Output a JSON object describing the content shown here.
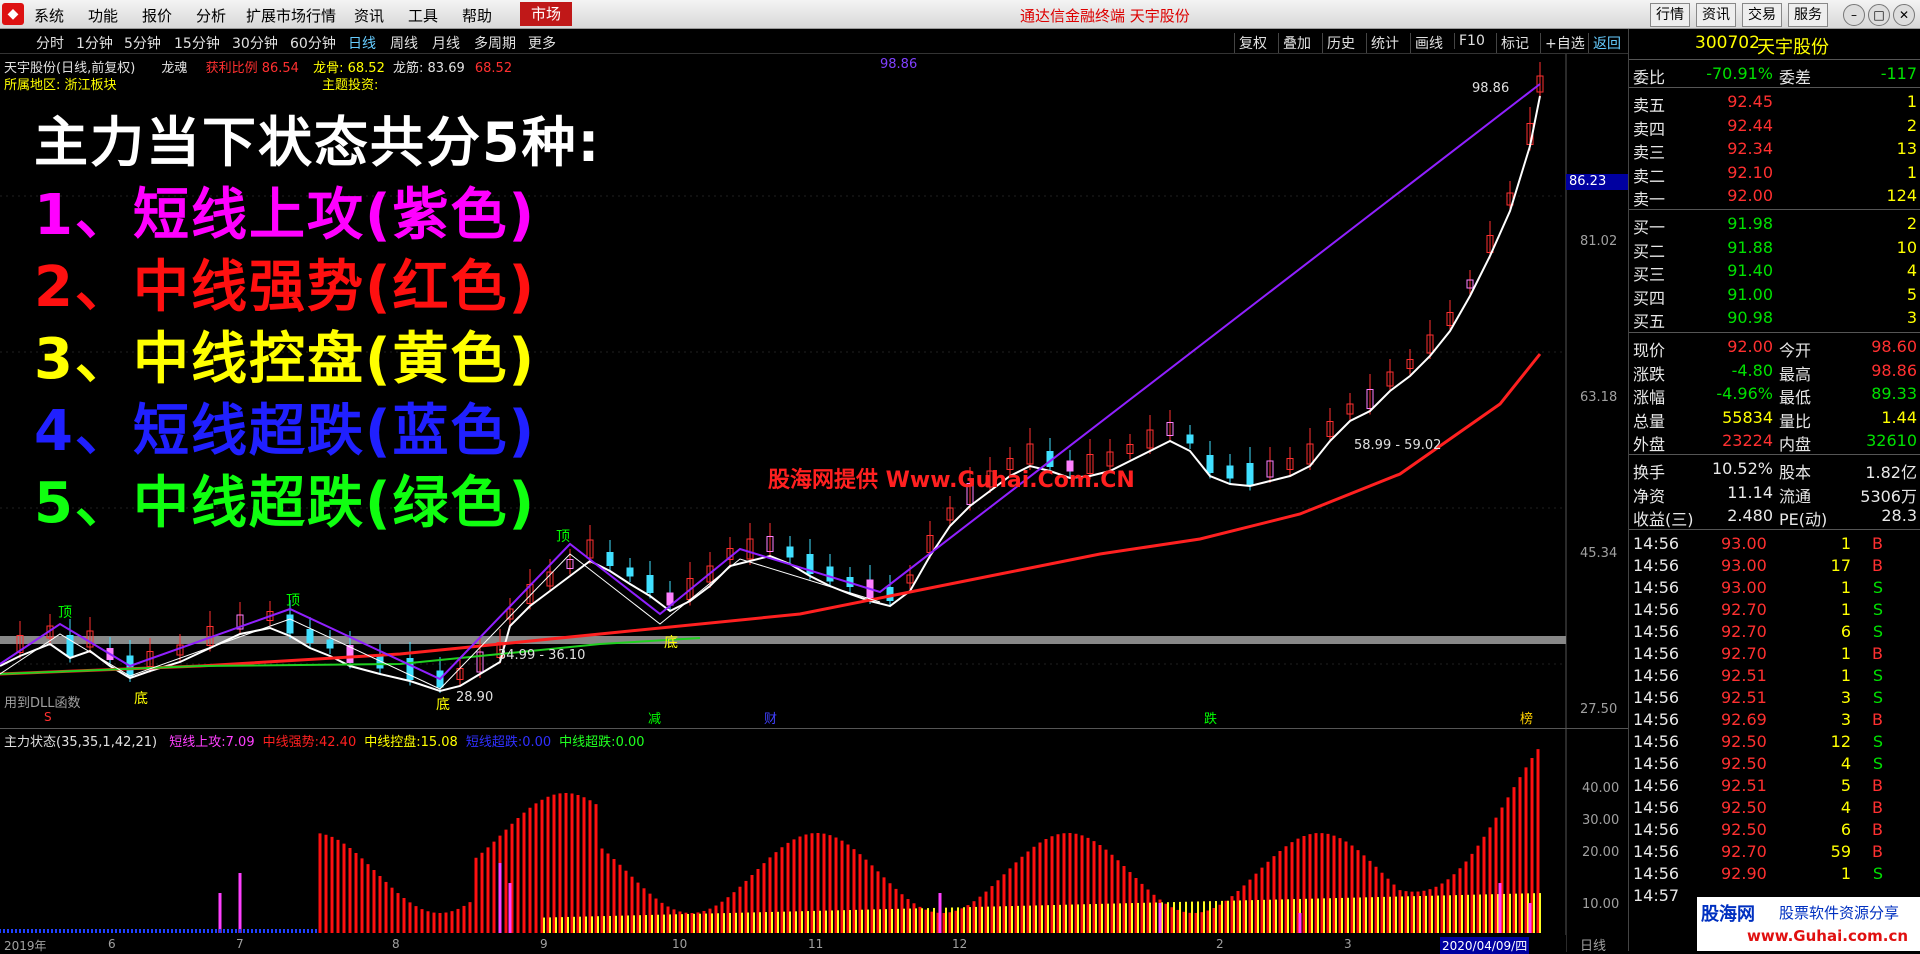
{
  "menu": {
    "items": [
      "系统",
      "功能",
      "报价",
      "分析",
      "扩展市场行情",
      "资讯",
      "工具",
      "帮助"
    ],
    "market_label": "市场",
    "center_title": "通达信金融终端 天宇股份",
    "right_buttons": [
      "行情",
      "资讯",
      "交易",
      "服务"
    ]
  },
  "periods": [
    "分时",
    "1分钟",
    "5分钟",
    "15分钟",
    "30分钟",
    "60分钟",
    "日线",
    "周线",
    "月线",
    "多周期",
    "更多"
  ],
  "tools": [
    "复权",
    "叠加",
    "历史",
    "统计",
    "画线",
    "F10",
    "标记",
    "+自选",
    "返回"
  ],
  "chart_header": {
    "stock": "天宇股份(日线,前复权)",
    "longhun": "龙魂",
    "profit_label": "获利比例",
    "profit_val": "86.54",
    "longgu_label": "龙骨:",
    "longgu_val": "68.52",
    "longjin_label": "龙筋:",
    "longjin_val": "83.69",
    "extra_val": "68.52",
    "top_price": "98.86",
    "region_label": "所属地区:",
    "region_val": "浙江板块",
    "theme_label": "主题投资:"
  },
  "overlay": {
    "heading": "主力当下状态共分5种:",
    "lines": [
      {
        "text": "1、短线上攻(紫色)",
        "color": "#ff00ff"
      },
      {
        "text": "2、中线强势(红色)",
        "color": "#ff1010"
      },
      {
        "text": "3、中线控盘(黄色)",
        "color": "#ffff00"
      },
      {
        "text": "4、短线超跌(蓝色)",
        "color": "#2020ff"
      },
      {
        "text": "5、中线超跌(绿色)",
        "color": "#10ff10"
      }
    ],
    "watermark": "股海网提供 Www.Guhai.Com.CN"
  },
  "price_axis": [
    "86.23",
    "81.02",
    "63.18",
    "45.34",
    "27.50"
  ],
  "chart_labels": {
    "peak1": "顶",
    "peak2": "顶",
    "peak3": "顶",
    "peak4": "顶",
    "bottom1": "底",
    "bottom2": "底",
    "bottom3": "底",
    "range1": "34.99 - 36.10",
    "low_price": "28.90",
    "range2": "58.99 - 59.02",
    "price_max": "98.86",
    "dll": "用到DLL函数",
    "event1": "减",
    "event2": "财",
    "event3": "跌",
    "event4": "榜",
    "event_s": "S"
  },
  "indicator": {
    "name": "主力状态(35,35,1,42,21)",
    "items": [
      {
        "label": "短线上攻:",
        "value": "7.09",
        "color": "#ff40ff"
      },
      {
        "label": "中线强势:",
        "value": "42.40",
        "color": "#ff2020"
      },
      {
        "label": "中线控盘:",
        "value": "15.08",
        "color": "#ffff00"
      },
      {
        "label": "短线超跌:",
        "value": "0.00",
        "color": "#3030ff"
      },
      {
        "label": "中线超跌:",
        "value": "0.00",
        "color": "#20ff20"
      }
    ],
    "axis": [
      "40.00",
      "30.00",
      "20.00",
      "10.00"
    ],
    "x_labels": [
      "2019年",
      "6",
      "7",
      "8",
      "9",
      "10",
      "11",
      "12",
      "2",
      "3",
      "2020/04/09/四"
    ],
    "period_label": "日线"
  },
  "quote": {
    "code": "300702",
    "name": "天宇股份",
    "webi_label": "委比",
    "webi": "-70.91%",
    "weicha_label": "委差",
    "weicha": "-117",
    "sells": [
      {
        "label": "卖五",
        "price": "92.45",
        "vol": "1"
      },
      {
        "label": "卖四",
        "price": "92.44",
        "vol": "2"
      },
      {
        "label": "卖三",
        "price": "92.34",
        "vol": "13"
      },
      {
        "label": "卖二",
        "price": "92.10",
        "vol": "1"
      },
      {
        "label": "卖一",
        "price": "92.00",
        "vol": "124"
      }
    ],
    "buys": [
      {
        "label": "买一",
        "price": "91.98",
        "vol": "2"
      },
      {
        "label": "买二",
        "price": "91.88",
        "vol": "10"
      },
      {
        "label": "买三",
        "price": "91.40",
        "vol": "4"
      },
      {
        "label": "买四",
        "price": "91.00",
        "vol": "5"
      },
      {
        "label": "买五",
        "price": "90.98",
        "vol": "3"
      }
    ],
    "stats": [
      {
        "l1": "现价",
        "v1": "92.00",
        "c1": "red",
        "l2": "今开",
        "v2": "98.60",
        "c2": "red"
      },
      {
        "l1": "涨跌",
        "v1": "-4.80",
        "c1": "green",
        "l2": "最高",
        "v2": "98.86",
        "c2": "red"
      },
      {
        "l1": "涨幅",
        "v1": "-4.96%",
        "c1": "green",
        "l2": "最低",
        "v2": "89.33",
        "c2": "green"
      },
      {
        "l1": "总量",
        "v1": "55834",
        "c1": "yellow",
        "l2": "量比",
        "v2": "1.44",
        "c2": "yellow"
      },
      {
        "l1": "外盘",
        "v1": "23224",
        "c1": "red",
        "l2": "内盘",
        "v2": "32610",
        "c2": "green"
      }
    ],
    "stats2": [
      {
        "l1": "换手",
        "v1": "10.52%",
        "l2": "股本",
        "v2": "1.82亿"
      },
      {
        "l1": "净资",
        "v1": "11.14",
        "l2": "流通",
        "v2": "5306万"
      },
      {
        "l1": "收益(三)",
        "v1": "2.480",
        "l2": "PE(动)",
        "v2": "28.3"
      }
    ],
    "ticks": [
      {
        "t": "14:56",
        "p": "93.00",
        "v": "1",
        "d": "B"
      },
      {
        "t": "14:56",
        "p": "93.00",
        "v": "17",
        "d": "B"
      },
      {
        "t": "14:56",
        "p": "93.00",
        "v": "1",
        "d": "S"
      },
      {
        "t": "14:56",
        "p": "92.70",
        "v": "1",
        "d": "S"
      },
      {
        "t": "14:56",
        "p": "92.70",
        "v": "6",
        "d": "S"
      },
      {
        "t": "14:56",
        "p": "92.70",
        "v": "1",
        "d": "B"
      },
      {
        "t": "14:56",
        "p": "92.51",
        "v": "1",
        "d": "S"
      },
      {
        "t": "14:56",
        "p": "92.51",
        "v": "3",
        "d": "S"
      },
      {
        "t": "14:56",
        "p": "92.69",
        "v": "3",
        "d": "B"
      },
      {
        "t": "14:56",
        "p": "92.50",
        "v": "12",
        "d": "S"
      },
      {
        "t": "14:56",
        "p": "92.50",
        "v": "4",
        "d": "S"
      },
      {
        "t": "14:56",
        "p": "92.51",
        "v": "5",
        "d": "B"
      },
      {
        "t": "14:56",
        "p": "92.50",
        "v": "4",
        "d": "B"
      },
      {
        "t": "14:56",
        "p": "92.50",
        "v": "6",
        "d": "B"
      },
      {
        "t": "14:56",
        "p": "92.70",
        "v": "59",
        "d": "B"
      },
      {
        "t": "14:56",
        "p": "92.90",
        "v": "1",
        "d": "S"
      },
      {
        "t": "14:57",
        "p": "",
        "v": "",
        "d": ""
      }
    ],
    "footer_logo": "股海网",
    "footer_tag": "股票软件资源分享",
    "footer_url": "www.Guhai.com.cn"
  }
}
